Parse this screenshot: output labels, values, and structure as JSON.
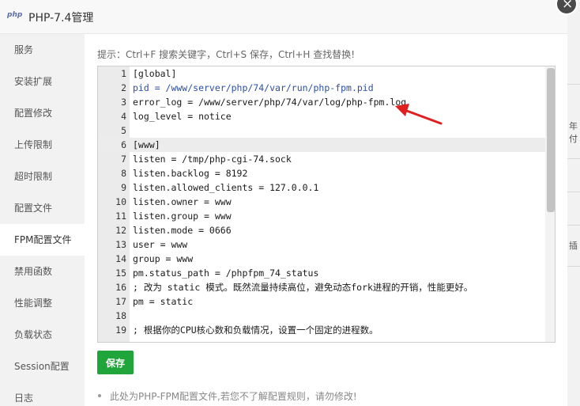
{
  "window": {
    "logo": "php",
    "title": "PHP-7.4管理",
    "close_symbol": "×"
  },
  "sidebar": {
    "items": [
      {
        "label": "服务"
      },
      {
        "label": "安装扩展"
      },
      {
        "label": "配置修改"
      },
      {
        "label": "上传限制"
      },
      {
        "label": "超时限制"
      },
      {
        "label": "配置文件"
      },
      {
        "label": "FPM配置文件",
        "active": true
      },
      {
        "label": "禁用函数"
      },
      {
        "label": "性能调整"
      },
      {
        "label": "负载状态"
      },
      {
        "label": "Session配置"
      },
      {
        "label": "日志"
      }
    ]
  },
  "editor": {
    "tip": "提示：Ctrl+F 搜索关键字，Ctrl+S 保存，Ctrl+H 查找替换!",
    "lines": [
      {
        "n": "1",
        "text": "[global]"
      },
      {
        "n": "2",
        "text": "pid = /www/server/php/74/var/run/php-fpm.pid"
      },
      {
        "n": "3",
        "text": "error_log = /www/server/php/74/var/log/php-fpm.log"
      },
      {
        "n": "4",
        "text": "log_level = notice"
      },
      {
        "n": "5",
        "text": ""
      },
      {
        "n": "6",
        "text": "[www]"
      },
      {
        "n": "7",
        "text": "listen = /tmp/php-cgi-74.sock"
      },
      {
        "n": "8",
        "text": "listen.backlog = 8192"
      },
      {
        "n": "9",
        "text": "listen.allowed_clients = 127.0.0.1"
      },
      {
        "n": "10",
        "text": "listen.owner = www"
      },
      {
        "n": "11",
        "text": "listen.group = www"
      },
      {
        "n": "12",
        "text": "listen.mode = 0666"
      },
      {
        "n": "13",
        "text": "user = www"
      },
      {
        "n": "14",
        "text": "group = www"
      },
      {
        "n": "15",
        "text": "pm.status_path = /phpfpm_74_status"
      },
      {
        "n": "16",
        "text": "; 改为 static 模式。既然流量持续高位，避免动态fork进程的开销，性能更好。"
      },
      {
        "n": "17",
        "text": "pm = static"
      },
      {
        "n": "18",
        "text": ""
      },
      {
        "n": "19",
        "text": "; 根据你的CPU核心数和负载情况，设置一个固定的进程数。"
      }
    ],
    "current_line": "6"
  },
  "actions": {
    "save_label": "保存"
  },
  "note": "此处为PHP-FPM配置文件,若您不了解配置规则，请勿修改!",
  "background": {
    "fragments": [
      "年付",
      "插"
    ]
  },
  "colors": {
    "accent": "#20a53a",
    "arrow": "#e02020",
    "sidebar_bg": "#f2f2f2"
  }
}
